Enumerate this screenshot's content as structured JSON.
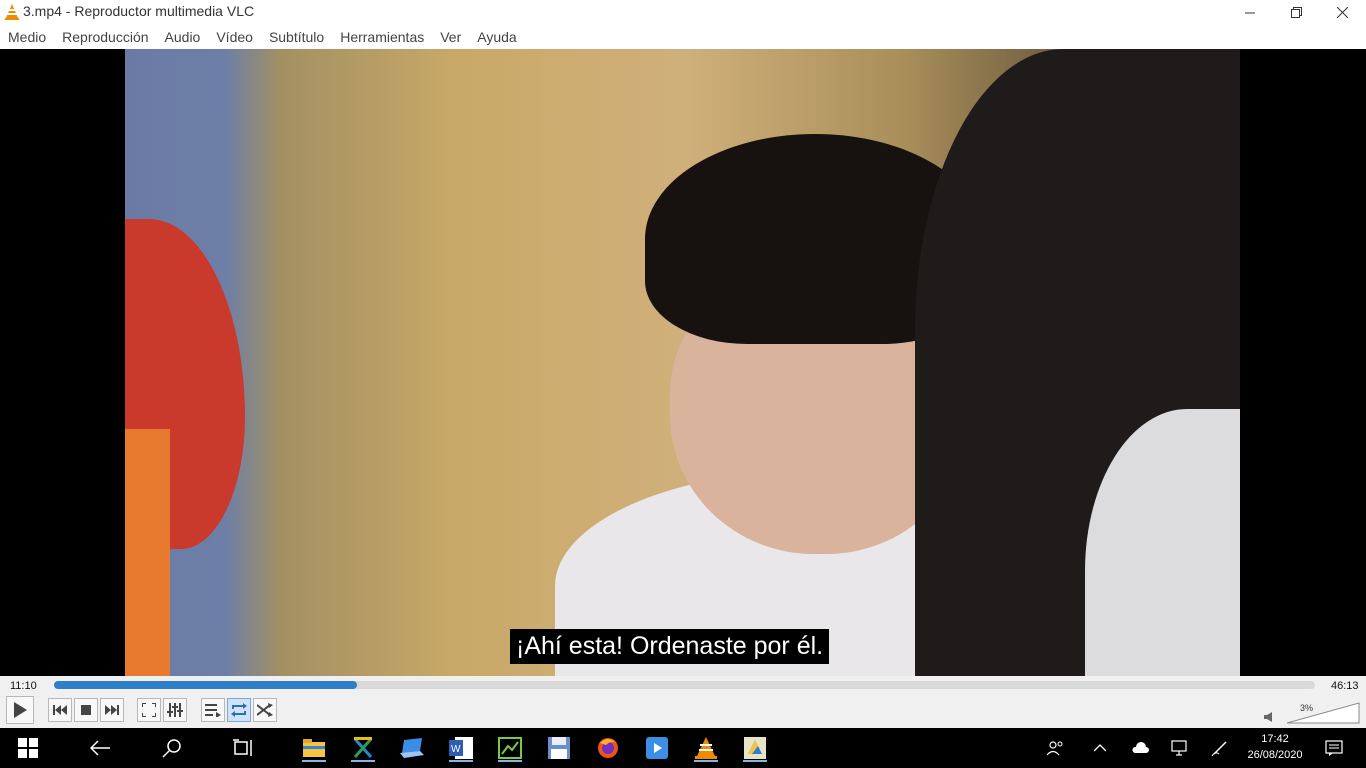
{
  "window": {
    "title": "3.mp4 - Reproductor multimedia VLC"
  },
  "menu": {
    "items": [
      "Medio",
      "Reproducción",
      "Audio",
      "Vídeo",
      "Subtítulo",
      "Herramientas",
      "Ver",
      "Ayuda"
    ]
  },
  "video": {
    "subtitle": "¡Ahí esta! Ordenaste por él."
  },
  "playback": {
    "elapsed": "11:10",
    "total": "46:13",
    "progress_fraction": 0.24,
    "volume_label": "3%"
  },
  "taskbar": {
    "time": "17:42",
    "date": "26/08/2020"
  },
  "colors": {
    "accent": "#2f7ec8",
    "vlc_orange": "#f08a00"
  }
}
